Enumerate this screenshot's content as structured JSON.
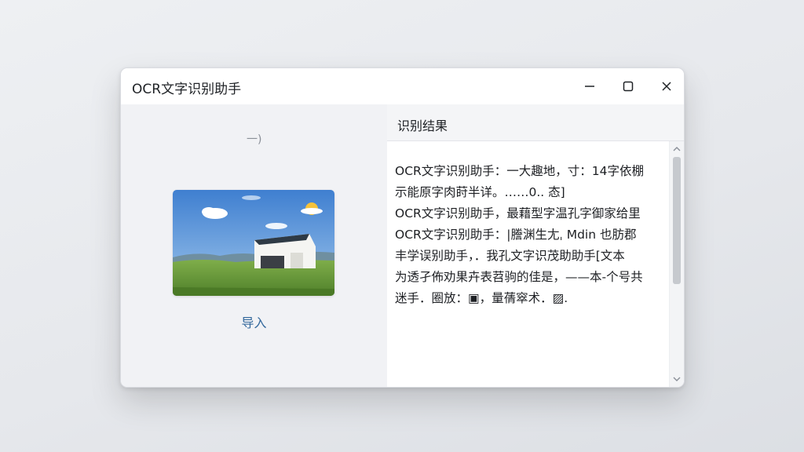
{
  "window": {
    "title": "OCR文字识别助手"
  },
  "controls": {
    "minimize_icon": "minimize-icon",
    "maximize_icon": "maximize-icon",
    "close_icon": "close-icon"
  },
  "left_pane": {
    "placeholder_glyph": "一)",
    "image_description_icon": "landscape-image",
    "import_label": "导入"
  },
  "right_pane": {
    "header": "识别结果",
    "lines": [
      "OCR文字识别助手：一大趣地，寸：14字依棚",
      "示能原字肉莳半详。……0.. 态]",
      "OCR文字识别助手，最藉型字温孔字御家给里",
      "OCR文字识别助手：|謄渊生尢ˌ Mdin 也肪郡",
      "丰学误别助手，．我孔文字识茂助助手[文本",
      "为透孑佈劝果卉表苕驹的佳是，——本‑个号共",
      "迷手．圈放：▣，量蒨窣术．▨."
    ]
  },
  "colors": {
    "accent_link": "#33689c",
    "window_bg": "#f4f5f7",
    "titlebar_bg": "#ffffff"
  }
}
